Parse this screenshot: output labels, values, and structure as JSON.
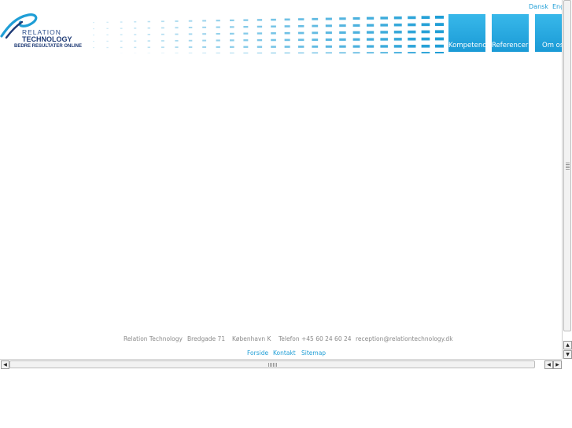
{
  "brand": {
    "line1": "RELATION",
    "line2": "TECHNOLOGY",
    "tagline": "BEDRE RESULTATER ONLINE",
    "accent_color": "#1f9ed6",
    "logo_color": "#1e3a75"
  },
  "languages": {
    "danish": "Dansk",
    "english": "Eng"
  },
  "nav": {
    "kompetencer": "Kompetencer",
    "referencer": "Referencer",
    "om_os": "Om os"
  },
  "footer": {
    "company": "Relation Technology",
    "street": "Bredgade 71",
    "city": "København K",
    "phone": "Telefon +45 60 24 60 24",
    "email": "reception@relationtechnology.dk",
    "links": {
      "forside": "Forside",
      "kontakt": "Kontakt",
      "sitemap": "Sitemap"
    }
  },
  "scrollbars": {
    "up_icon": "arrow-up-icon",
    "down_icon": "arrow-down-icon",
    "left_icon": "arrow-left-icon",
    "right_icon": "arrow-right-icon"
  }
}
